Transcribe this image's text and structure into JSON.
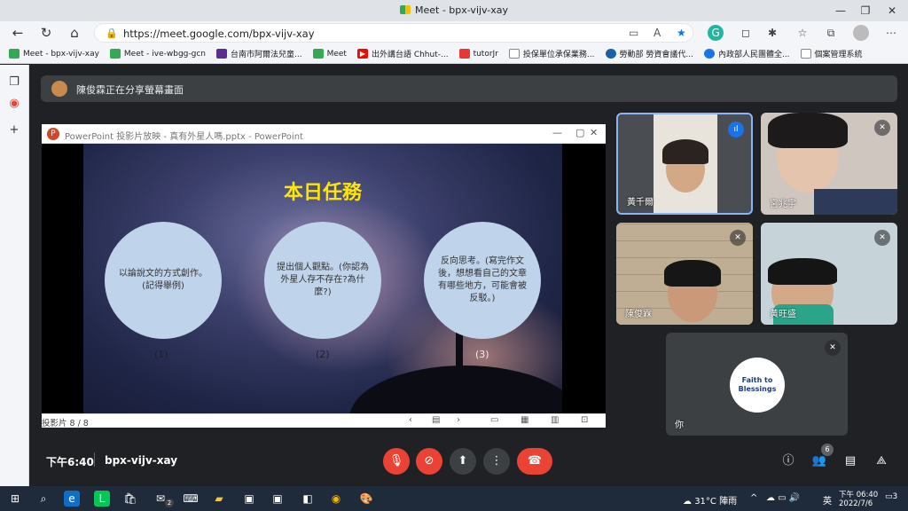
{
  "browser": {
    "tab_title": "Meet - bpx-vijv-xay",
    "url": "https://meet.google.com/bpx-vijv-xay",
    "window_controls": [
      "minimize-icon",
      "restore-icon",
      "close-icon"
    ]
  },
  "bookmarks": [
    {
      "label": "Meet - bpx-vijv-xay",
      "color": "#34a853"
    },
    {
      "label": "Meet - ive-wbgg-gcn",
      "color": "#34a853"
    },
    {
      "label": "台南市阿爾法兒童...",
      "color": "#5c2d91"
    },
    {
      "label": "Meet",
      "color": "#34a853"
    },
    {
      "label": "出外講台語 Chhut-...",
      "color": "#ff0000"
    },
    {
      "label": "tutorJr",
      "color": "#e53935"
    },
    {
      "label": "投保單位承保業務...",
      "color": "#888888"
    },
    {
      "label": "勞動部 勞資會議代...",
      "color": "#1a5fa8"
    },
    {
      "label": "內政部人民團體全...",
      "color": "#1a73e8"
    },
    {
      "label": "個案管理系統",
      "color": "#888888"
    }
  ],
  "meet": {
    "share_status": "陳俊霖正在分享螢幕畫面",
    "time": "下午6:40",
    "meeting_code": "bpx-vijv-xay",
    "participants_count": "6"
  },
  "ppt": {
    "window_title": "PowerPoint 投影片放映 - 真有外星人嗎.pptx - PowerPoint",
    "slide_counter": "投影片 8 / 8",
    "slide_title": "本日任務",
    "tasks": [
      {
        "text": "以論說文的方式創作。(記得舉例)",
        "num": "(1)"
      },
      {
        "text": "提出個人觀點。(你認為外星人存不存在?為什麼?)",
        "num": "(2)"
      },
      {
        "text": "反向思考。(寫完作文後，想想看自己的文章有哪些地方，可能會被反駁。)",
        "num": "(3)"
      }
    ]
  },
  "tiles": [
    {
      "name": "黃千爾"
    },
    {
      "name": "宮兆宇"
    },
    {
      "name": "陳俊霖"
    },
    {
      "name": "黃旺盛"
    },
    {
      "name": "你",
      "logo_line1": "Faith to",
      "logo_line2": "Blessings"
    }
  ],
  "taskbar": {
    "weather": "31°C 陣雨",
    "ime": "英",
    "clock_time": "下午 06:40",
    "clock_date": "2022/7/6",
    "notifications": "3",
    "mail_badge": "2"
  }
}
